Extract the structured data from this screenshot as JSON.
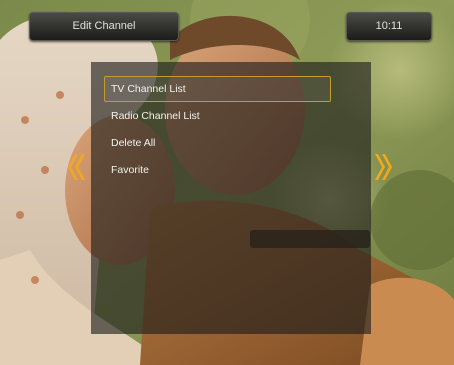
{
  "header": {
    "title": "Edit Channel",
    "clock": "10:11"
  },
  "menu": {
    "items": [
      {
        "label": "TV Channel List",
        "selected": true
      },
      {
        "label": "Radio Channel List",
        "selected": false
      },
      {
        "label": "Delete All",
        "selected": false
      },
      {
        "label": "Favorite",
        "selected": false
      }
    ]
  },
  "icons": {
    "left": "double-chevron-left-icon",
    "right": "double-chevron-right-icon"
  },
  "colors": {
    "accent": "#f2a81a",
    "selection_border": "#c79a2e"
  }
}
